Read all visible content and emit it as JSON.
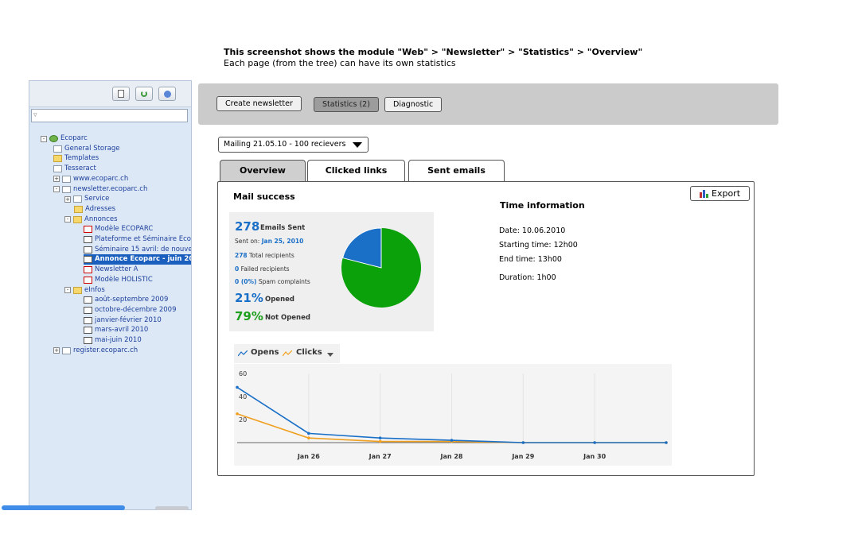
{
  "caption": {
    "line1": "This screenshot shows the module \"Web\" > \"Newsletter\"  > \"Statistics\" > \"Overview\"",
    "line2": "Each page (from the tree) can have its own statistics"
  },
  "tree": {
    "filter_placeholder": "",
    "items": [
      {
        "label": "Ecoparc"
      },
      {
        "label": "General Storage"
      },
      {
        "label": "Templates"
      },
      {
        "label": "Tesseract"
      },
      {
        "label": "www.ecoparc.ch"
      },
      {
        "label": "newsletter.ecoparc.ch"
      },
      {
        "label": "Service"
      },
      {
        "label": "Adresses"
      },
      {
        "label": "Annonces"
      },
      {
        "label": "Modèle ECOPARC"
      },
      {
        "label": "Plateforme et Séminaire Ecop"
      },
      {
        "label": "Séminaire 15 avril: de nouve"
      },
      {
        "label": "Annonce Ecoparc - juin 20"
      },
      {
        "label": "Newsletter A"
      },
      {
        "label": "Modèle HOLISTIC"
      },
      {
        "label": "eInfos"
      },
      {
        "label": "août-septembre 2009"
      },
      {
        "label": "octobre-décembre 2009"
      },
      {
        "label": "janvier-février 2010"
      },
      {
        "label": "mars-avril 2010"
      },
      {
        "label": "mai-juin 2010"
      },
      {
        "label": "register.ecoparc.ch"
      }
    ]
  },
  "toolbar": {
    "create_label": "Create newsletter",
    "statistics_label": "Statistics (2)",
    "diagnostic_label": "Diagnostic"
  },
  "mailing_select": {
    "selected": "Mailing 21.05.10 - 100 recievers"
  },
  "tabs": [
    {
      "label": "Overview",
      "active": true
    },
    {
      "label": "Clicked links",
      "active": false
    },
    {
      "label": "Sent emails",
      "active": false
    }
  ],
  "panel": {
    "mail_success_title": "Mail success",
    "export_label": "Export",
    "stats": {
      "emails_sent_value": "278",
      "emails_sent_label": "Emails Sent",
      "sent_on_label": "Sent on:",
      "sent_on_value": "Jan 25, 2010",
      "total_value": "278",
      "total_label": "Total recipients",
      "failed_value": "0",
      "failed_label": "Failed recipients",
      "spam_value": "0 (0%)",
      "spam_label": "Spam complaints",
      "opened_value": "21%",
      "opened_label": "Opened",
      "not_opened_value": "79%",
      "not_opened_label": "Not Opened"
    },
    "time_info": {
      "title": "Time information",
      "date": "Date: 10.06.2010",
      "start": "Starting time: 12h00",
      "end": "End time: 13h00",
      "duration": "Duration: 1h00"
    },
    "legend": {
      "opens": "Opens",
      "clicks": "Clicks"
    }
  },
  "pie": {
    "opened_fraction": 0.21,
    "opened_color": "#1a6fc7",
    "not_opened_color": "#0aa10a"
  },
  "chart_data": {
    "type": "line",
    "x": [
      "",
      "Jan 26",
      "Jan 27",
      "Jan 28",
      "Jan 29",
      "Jan 30",
      ""
    ],
    "series": [
      {
        "name": "Opens",
        "color": "#1a6fc7",
        "values": [
          48,
          8,
          4,
          2,
          0,
          0,
          0
        ]
      },
      {
        "name": "Clicks",
        "color": "#f0a020",
        "values": [
          25,
          4,
          1,
          1,
          0,
          0,
          0
        ]
      }
    ],
    "y_ticks": [
      "60",
      "40",
      "20"
    ],
    "ylim": [
      0,
      60
    ]
  }
}
